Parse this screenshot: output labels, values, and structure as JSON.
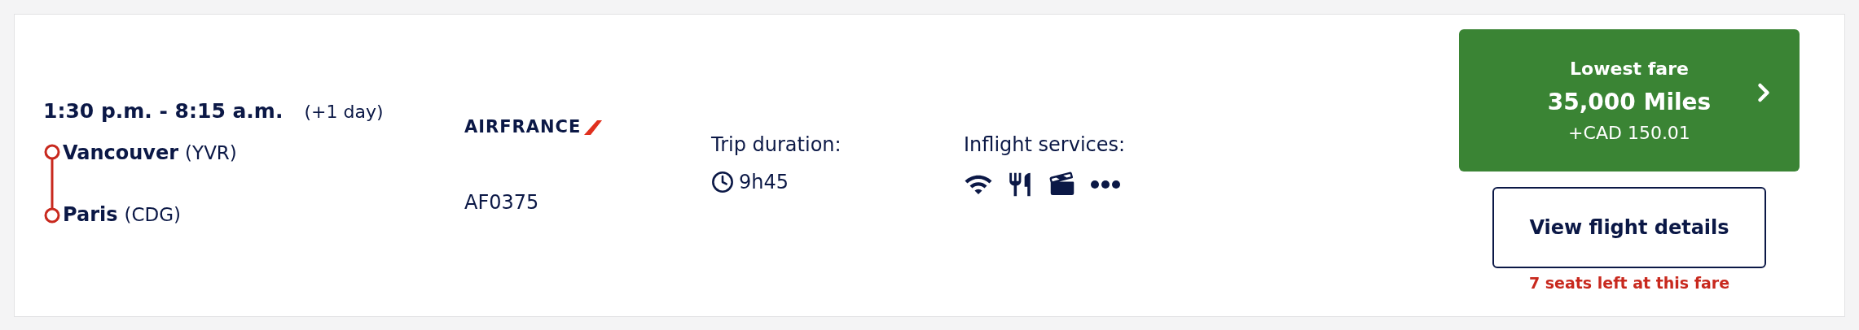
{
  "itinerary": {
    "times": "1:30 p.m. - 8:15 a.m.",
    "day_offset": "(+1 day)",
    "stops": [
      {
        "city": "Vancouver",
        "code": "(YVR)"
      },
      {
        "city": "Paris",
        "code": "(CDG)"
      }
    ]
  },
  "airline": {
    "logo": "AIRFRANCE",
    "flight_number": "AF0375"
  },
  "duration": {
    "label": "Trip duration:",
    "value": "9h45"
  },
  "services": {
    "label": "Inflight services:",
    "items": [
      {
        "kind": "wifi"
      },
      {
        "kind": "meal"
      },
      {
        "kind": "entertainment"
      },
      {
        "kind": "more"
      }
    ]
  },
  "fare": {
    "label": "Lowest fare",
    "miles": "35,000 Miles",
    "taxes": "+CAD 150.01"
  },
  "details_button": "View flight details",
  "seats_left": "7 seats left at this fare"
}
